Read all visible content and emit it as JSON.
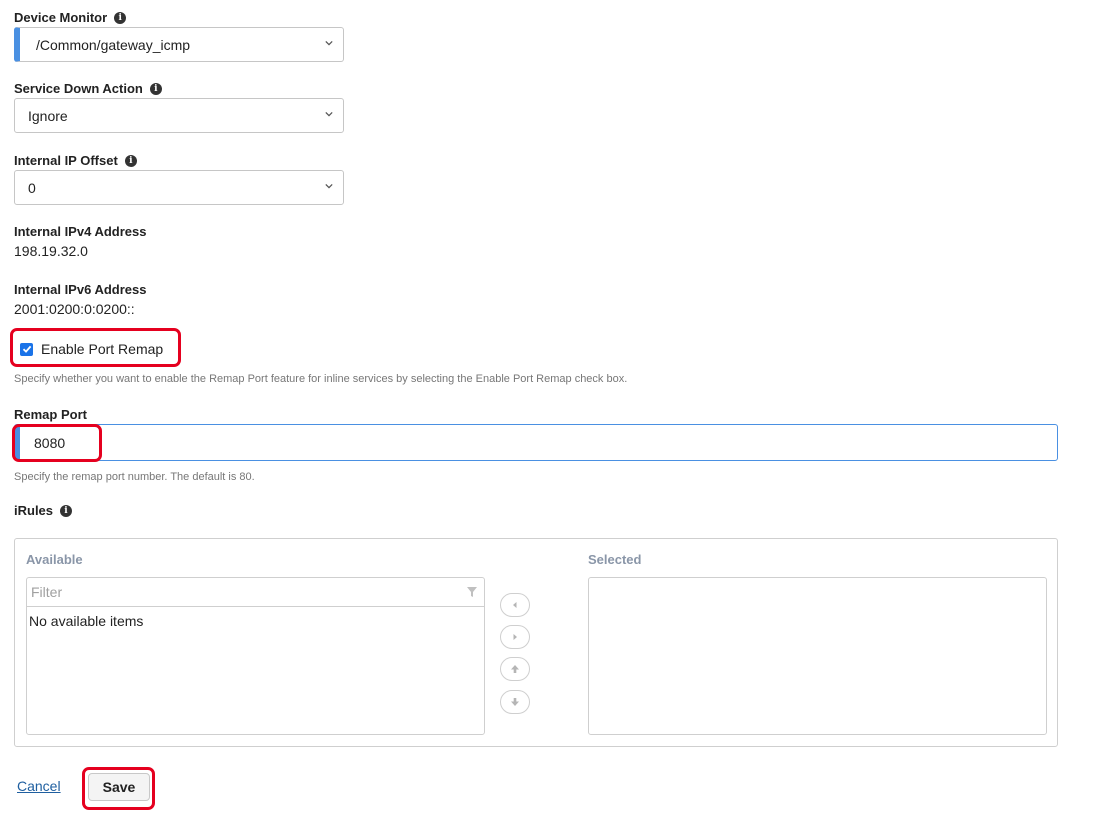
{
  "device_monitor": {
    "label": "Device Monitor",
    "value": "/Common/gateway_icmp"
  },
  "service_down_action": {
    "label": "Service Down Action",
    "value": "Ignore"
  },
  "internal_ip_offset": {
    "label": "Internal IP Offset",
    "value": "0"
  },
  "internal_ipv4": {
    "label": "Internal IPv4 Address",
    "value": "198.19.32.0"
  },
  "internal_ipv6": {
    "label": "Internal IPv6 Address",
    "value": "2001:0200:0:0200::"
  },
  "port_remap": {
    "label": "Enable Port Remap",
    "checked": true,
    "help": "Specify whether you want to enable the Remap Port feature for inline services by selecting the Enable Port Remap check box."
  },
  "remap_port": {
    "label": "Remap Port",
    "value": "8080",
    "help": "Specify the remap port number. The default is 80."
  },
  "irules": {
    "label": "iRules",
    "available_title": "Available",
    "selected_title": "Selected",
    "filter_placeholder": "Filter",
    "empty_text": "No available items"
  },
  "actions": {
    "cancel": "Cancel",
    "save": "Save"
  },
  "colors": {
    "accent": "#4a90e2",
    "highlight": "#e5001f",
    "checkbox": "#1a73e8"
  },
  "icons": [
    "info-icon",
    "chevron-down-icon",
    "filter-icon",
    "arrow-left-icon",
    "arrow-right-icon",
    "arrow-up-icon",
    "arrow-down-icon",
    "checkmark-icon"
  ]
}
